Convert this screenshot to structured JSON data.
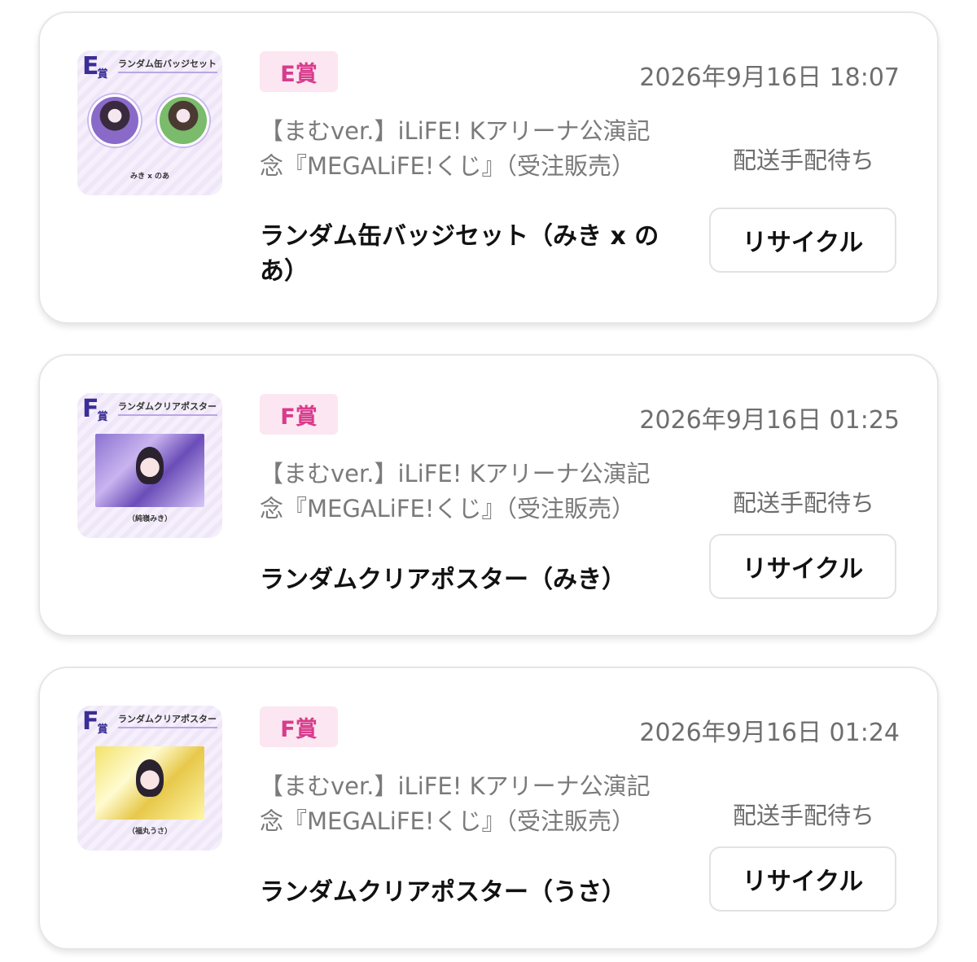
{
  "items": [
    {
      "thumb": {
        "prize_letter": "E",
        "prize_suffix": "賞",
        "title": "ランダム缶バッジセット",
        "caption": "みき x のあ"
      },
      "prize": "E賞",
      "date": "2026年9月16日 18:07",
      "campaign": "【まむver.】iLiFE! Kアリーナ公演記念『MEGALiFE!くじ』（受注販売）",
      "product": "ランダム缶バッジセット（みき x のあ）",
      "status": "配送手配待ち",
      "action": "リサイクル"
    },
    {
      "thumb": {
        "prize_letter": "F",
        "prize_suffix": "賞",
        "title": "ランダムクリアポスター",
        "caption": "（純嶺みき）"
      },
      "prize": "F賞",
      "date": "2026年9月16日 01:25",
      "campaign": "【まむver.】iLiFE! Kアリーナ公演記念『MEGALiFE!くじ』（受注販売）",
      "product": "ランダムクリアポスター（みき）",
      "status": "配送手配待ち",
      "action": "リサイクル"
    },
    {
      "thumb": {
        "prize_letter": "F",
        "prize_suffix": "賞",
        "title": "ランダムクリアポスター",
        "caption": "（福丸うさ）"
      },
      "prize": "F賞",
      "date": "2026年9月16日 01:24",
      "campaign": "【まむver.】iLiFE! Kアリーナ公演記念『MEGALiFE!くじ』（受注販売）",
      "product": "ランダムクリアポスター（うさ）",
      "status": "配送手配待ち",
      "action": "リサイクル"
    }
  ],
  "colors": {
    "prize_text": "#d83c8c",
    "prize_bg": "#fbe6f1",
    "badge_brand": "#3b2d96"
  }
}
